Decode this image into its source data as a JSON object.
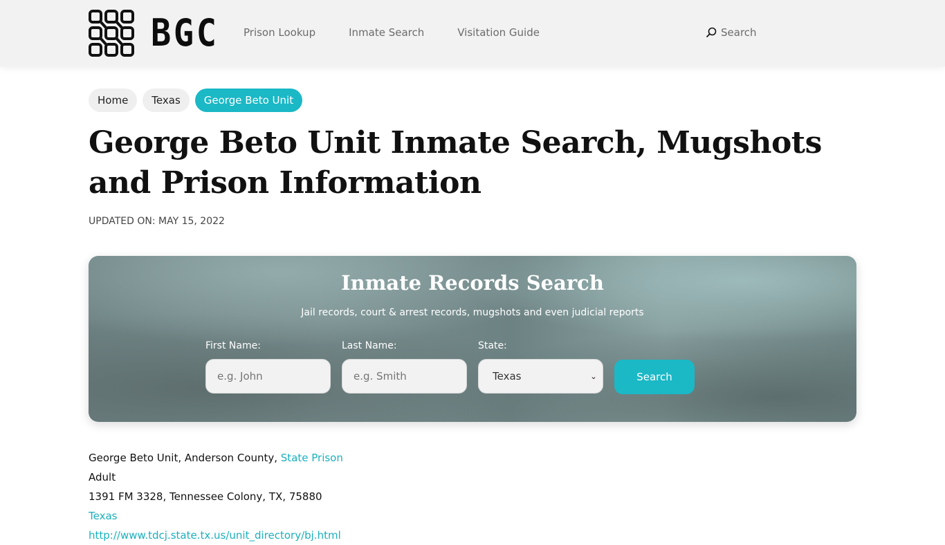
{
  "header": {
    "logo_text": "BGC",
    "nav": [
      "Prison Lookup",
      "Inmate Search",
      "Visitation Guide"
    ],
    "search_label": "Search"
  },
  "breadcrumb": [
    "Home",
    "Texas",
    "George Beto Unit"
  ],
  "page": {
    "title": "George Beto Unit Inmate Search, Mugshots and Prison Information",
    "updated": "UPDATED ON: MAY 15, 2022"
  },
  "search_card": {
    "title": "Inmate Records Search",
    "subtitle": "Jail records, court & arrest records, mugshots and even judicial reports",
    "first_name": {
      "label": "First Name:",
      "placeholder": "e.g. John",
      "value": ""
    },
    "last_name": {
      "label": "Last Name:",
      "placeholder": "e.g. Smith",
      "value": ""
    },
    "state": {
      "label": "State:",
      "selected": "Texas"
    },
    "button": "Search",
    "accent": "#1bb8c6"
  },
  "info": {
    "line1_text": "George Beto Unit, Anderson County, ",
    "line1_link": "State Prison",
    "line2": "Adult",
    "line3": "1391 FM 3328, Tennessee Colony, TX, 75880",
    "line4_link": "Texas",
    "line5_link": "http://www.tdcj.state.tx.us/unit_directory/bj.html"
  }
}
